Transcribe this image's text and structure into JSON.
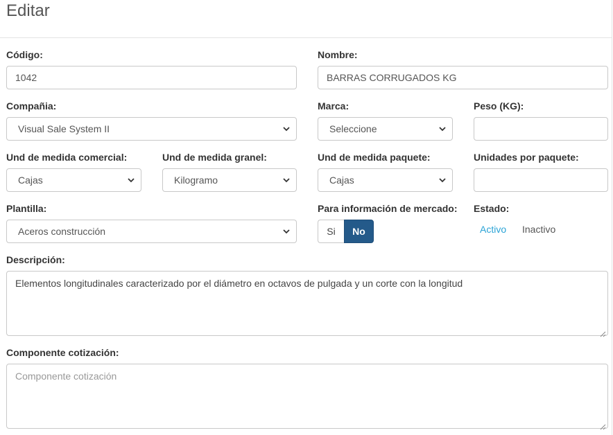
{
  "header": {
    "title": "Editar"
  },
  "form": {
    "codigo": {
      "label": "Código:",
      "value": "1042"
    },
    "nombre": {
      "label": "Nombre:",
      "value": "BARRAS CORRUGADOS KG"
    },
    "compania": {
      "label": "Compañia:",
      "value": "Visual Sale System II"
    },
    "marca": {
      "label": "Marca:",
      "value": "Seleccione"
    },
    "peso": {
      "label": "Peso (KG):",
      "value": ""
    },
    "und_comercial": {
      "label": "Und de medida comercial:",
      "value": "Cajas"
    },
    "und_granel": {
      "label": "Und de medida granel:",
      "value": "Kilogramo"
    },
    "und_paquete": {
      "label": "Und de medida paquete:",
      "value": "Cajas"
    },
    "unidades_paquete": {
      "label": "Unidades por paquete:",
      "value": ""
    },
    "plantilla": {
      "label": "Plantilla:",
      "value": "Aceros construcción"
    },
    "mercado": {
      "label": "Para información de mercado:",
      "options": [
        "Si",
        "No"
      ],
      "selected": "No"
    },
    "estado": {
      "label": "Estado:",
      "options": [
        "Activo",
        "Inactivo"
      ],
      "selected": "Activo"
    },
    "descripcion": {
      "label": "Descripción:",
      "value": "Elementos longitudinales caracterizado por el diámetro en octavos de pulgada y un corte con la longitud"
    },
    "componente": {
      "label": "Componente cotización:",
      "value": "",
      "placeholder": "Componente cotización"
    }
  },
  "colors": {
    "active_toggle": "#245a8a",
    "active_link": "#2aa3d6",
    "border": "#c8c8c8"
  }
}
